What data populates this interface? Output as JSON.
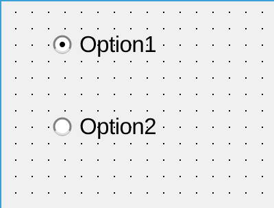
{
  "options": [
    {
      "label": "Option1",
      "checked": true
    },
    {
      "label": "Option2",
      "checked": false
    }
  ],
  "colors": {
    "background": "#f0f0f0",
    "border_accent": "#3aa0d8",
    "grid_dot": "#000000",
    "text": "#000000"
  }
}
